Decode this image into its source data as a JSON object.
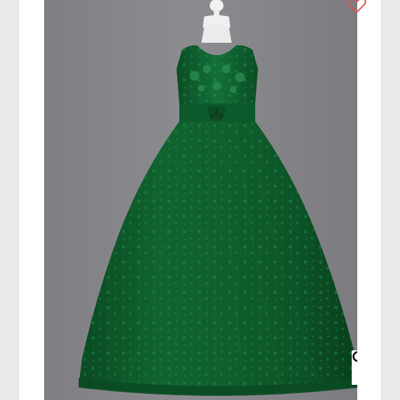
{
  "product": {
    "image_alt": "",
    "accent_color": "#e0524f",
    "dress_color": "#0d5a2c"
  },
  "icons": {
    "favorite": "heart-outline-icon",
    "zoom": "magnifier-icon"
  }
}
